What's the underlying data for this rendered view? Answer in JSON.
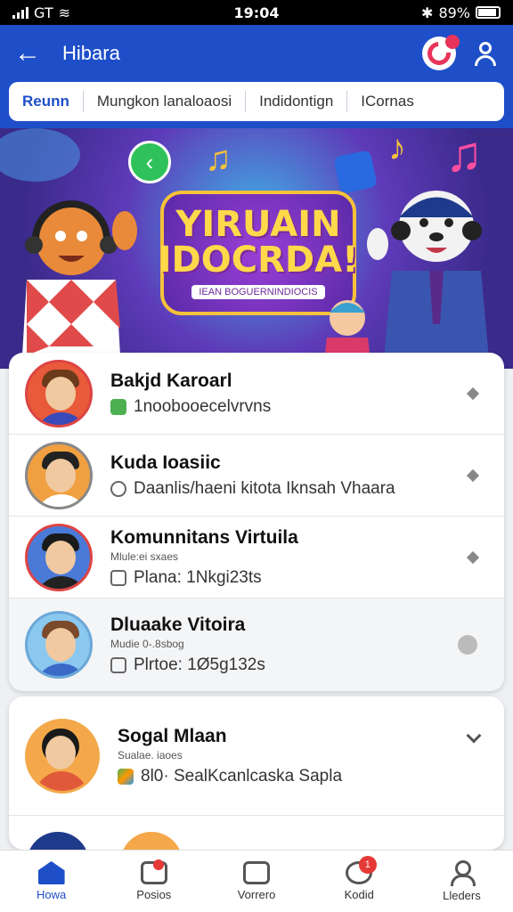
{
  "status_bar": {
    "carrier": "GT",
    "time": "19:04",
    "battery": "89%"
  },
  "header": {
    "title": "Hibara"
  },
  "tabs": [
    {
      "label": "Reunn",
      "active": true
    },
    {
      "label": "Mungkon lanaloaosi",
      "active": false
    },
    {
      "label": "Indidontign",
      "active": false
    },
    {
      "label": "ICornas",
      "active": false
    }
  ],
  "banner": {
    "title_line1": "YIRUAIN",
    "title_line2": "IDOCRDA!",
    "subtitle": "IEAN BOGUERNINDIOCIS"
  },
  "list": [
    {
      "name": "Bakjd Karoarl",
      "meta": "",
      "sub": "1noobooecelvrvns",
      "sub_icon": "green-square-icon"
    },
    {
      "name": "Kuda Ioasiic",
      "meta": "",
      "sub": "Daanlis/haeni kitota Iknsah Vhaara",
      "sub_icon": "clock-icon"
    },
    {
      "name": "Komunnitans Virtuila",
      "meta": "Mlule:ei sxaes",
      "sub": "Plana: 1Nkgi23ts",
      "sub_icon": "edit-icon"
    },
    {
      "name": "Dluaake Vitoira",
      "meta": "Mudie 0-.8sbog",
      "sub": "Plrtoe: 1Ø5g132s",
      "sub_icon": "edit-icon"
    }
  ],
  "second_card": {
    "name": "Sogal Mlaan",
    "meta": "Sualae. iaoes",
    "sub": "8l0· SealKcanlcaska Sapla"
  },
  "bottom_nav": [
    {
      "label": "Howa",
      "active": true
    },
    {
      "label": "Posios",
      "active": false
    },
    {
      "label": "Vorrero",
      "active": false
    },
    {
      "label": "Kodid",
      "active": false,
      "badge": "1"
    },
    {
      "label": "Lleders",
      "active": false
    }
  ]
}
